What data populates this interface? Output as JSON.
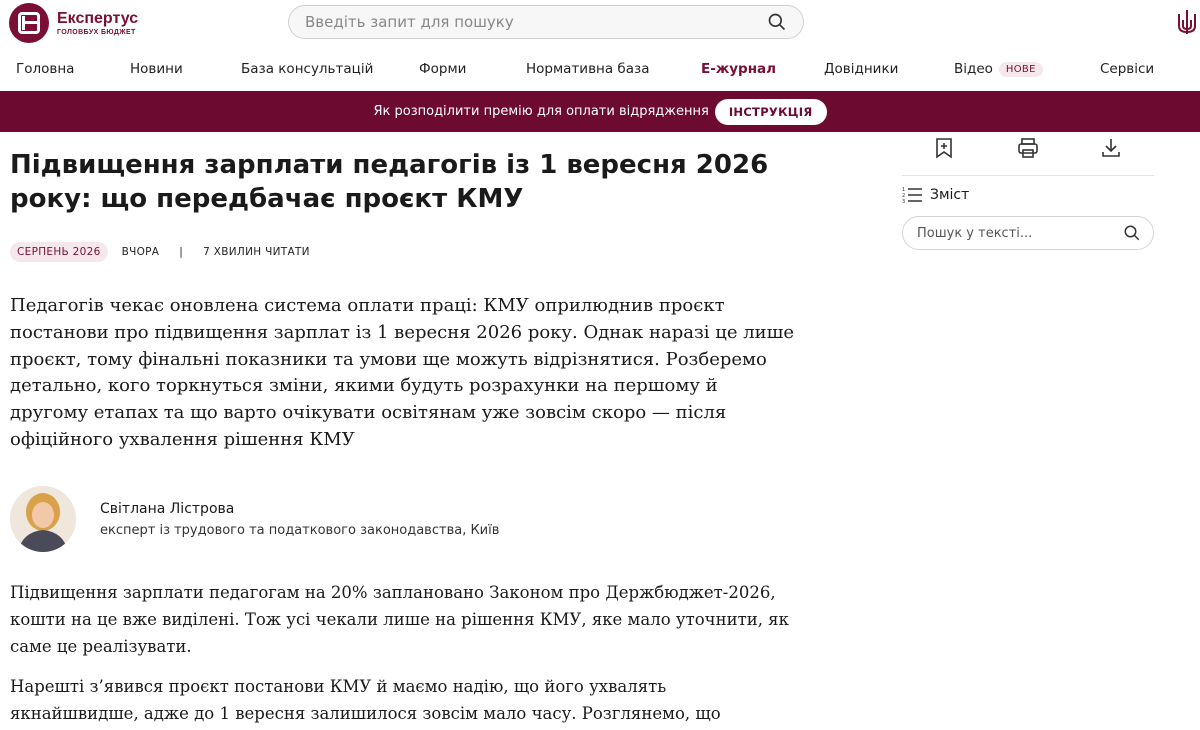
{
  "header": {
    "logo_name": "Експертус",
    "logo_sub": "ГОЛОВБУХ БЮДЖЕТ",
    "search_placeholder": "Введіть запит для пошуку"
  },
  "nav": {
    "items": [
      {
        "label": "Головна"
      },
      {
        "label": "Новини"
      },
      {
        "label": "База консультацій"
      },
      {
        "label": "Форми"
      },
      {
        "label": "Нормативна база"
      },
      {
        "label": "Е-журнал",
        "active": true
      },
      {
        "label": "Довідники"
      },
      {
        "label": "Відео",
        "badge": "НОВЕ"
      },
      {
        "label": "Сервіси"
      }
    ]
  },
  "banner": {
    "text": "Як розподілити премію для оплати відрядження",
    "button": "ІНСТРУКЦІЯ"
  },
  "article": {
    "title": "Підвищення зарплати педагогів із 1 вересня 2026 року: що передбачає проєкт КМУ",
    "tag": "СЕРПЕНЬ 2026",
    "when": "ВЧОРА",
    "separator": "|",
    "read_time": "7 ХВИЛИН ЧИТАТИ",
    "lead": "Педагогів чекає оновлена система оплати праці: КМУ оприлюднив проєкт постанови про підвищення зарплат із 1 вересня 2026 року. Однак наразі це лише проєкт, тому фінальні показники та умови ще можуть відрізнятися. Розберемо детально, кого торкнуться зміни, якими будуть розрахунки на першому й другому етапах та що варто очікувати освітянам уже зовсім скоро — після офіційного ухвалення рішення КМУ",
    "author_name": "Світлана Лістрова",
    "author_role": "експерт із трудового та податкового законодавства, Київ",
    "paragraph_1": "Підвищення зарплати педагогам на 20% заплановано Законом про Держбюджет-2026, кошти на це вже виділені. Тож усі чекали лише на рішення КМУ, яке мало уточнити, як саме це реалізувати.",
    "paragraph_2": "Нарешті з’явився проєкт постанови КМУ й маємо надію, що його ухвалять якнайшвидше, адже до 1 вересня залишилося зовсім мало часу. Розглянемо, що пропонують урядовці."
  },
  "sidebar": {
    "toc_label": "Зміст",
    "search_placeholder": "Пошук у тексті..."
  },
  "colors": {
    "brand": "#7a0e35",
    "banner_bg": "#6d0a30",
    "tag_bg": "#f5e8ec"
  },
  "icons": {
    "search": "search-icon",
    "trident": "trident-icon",
    "bookmark": "bookmark-add-icon",
    "print": "print-icon",
    "download": "download-icon",
    "toc": "list-icon"
  }
}
